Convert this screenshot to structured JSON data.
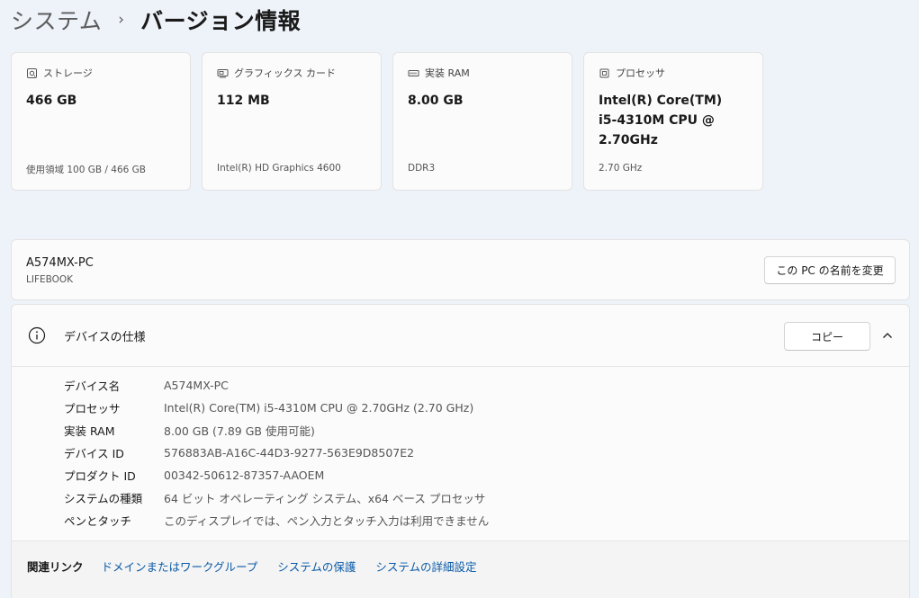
{
  "breadcrumb": {
    "parent": "システム",
    "separator": "›",
    "current": "バージョン情報"
  },
  "cards": [
    {
      "icon": "storage-icon",
      "label": "ストレージ",
      "value": "466 GB",
      "sub": "使用領域 100 GB / 466 GB"
    },
    {
      "icon": "graphics-card-icon",
      "label": "グラフィックス カード",
      "value": "112 MB",
      "sub": "Intel(R) HD Graphics 4600"
    },
    {
      "icon": "ram-icon",
      "label": "実装 RAM",
      "value": "8.00 GB",
      "sub": "DDR3"
    },
    {
      "icon": "processor-icon",
      "label": "プロセッサ",
      "value": "Intel(R) Core(TM) i5-4310M CPU @ 2.70GHz",
      "sub": "2.70 GHz"
    }
  ],
  "pc": {
    "name": "A574MX-PC",
    "model": "LIFEBOOK",
    "rename_label": "この PC の名前を変更"
  },
  "specs": {
    "title": "デバイスの仕様",
    "copy_label": "コピー",
    "rows": [
      {
        "key": "デバイス名",
        "value": "A574MX-PC"
      },
      {
        "key": "プロセッサ",
        "value": "Intel(R) Core(TM) i5-4310M CPU @ 2.70GHz (2.70 GHz)"
      },
      {
        "key": "実装 RAM",
        "value": "8.00 GB (7.89 GB 使用可能)"
      },
      {
        "key": "デバイス ID",
        "value": "576883AB-A16C-44D3-9277-563E9D8507E2"
      },
      {
        "key": "プロダクト ID",
        "value": "00342-50612-87357-AAOEM"
      },
      {
        "key": "システムの種類",
        "value": "64 ビット オペレーティング システム、x64 ベース プロセッサ"
      },
      {
        "key": "ペンとタッチ",
        "value": "このディスプレイでは、ペン入力とタッチ入力は利用できません"
      }
    ]
  },
  "related_links": {
    "label": "関連リンク",
    "links": [
      "ドメインまたはワークグループ",
      "システムの保護",
      "システムの詳細設定"
    ]
  }
}
